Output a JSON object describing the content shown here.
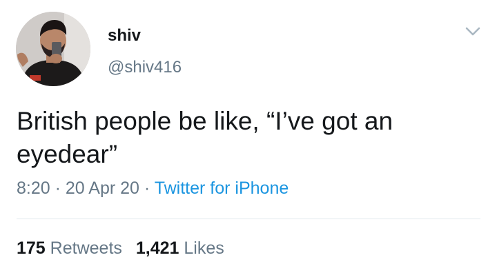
{
  "author": {
    "display_name": "shiv",
    "handle": "@shiv416"
  },
  "tweet": {
    "text": "British people be like, “I’ve got an\neyedear”",
    "time": "8:20",
    "separator": "·",
    "date": "20 Apr 20",
    "source": "Twitter for iPhone"
  },
  "stats": {
    "retweets_count": "175",
    "retweets_label": "Retweets",
    "likes_count": "1,421",
    "likes_label": "Likes"
  },
  "icons": {
    "menu": "chevron-down-icon",
    "avatar": "profile-photo"
  },
  "colors": {
    "text": "#14171a",
    "muted": "#657786",
    "link": "#1b95e0",
    "divider": "#e1e8ed"
  }
}
